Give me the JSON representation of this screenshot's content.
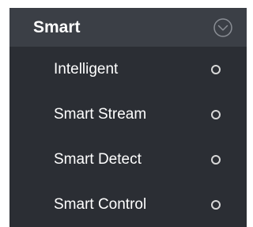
{
  "header": {
    "title": "Smart",
    "toggle_icon": "chevron-down-circle-icon"
  },
  "menu": {
    "items": [
      {
        "label": "Intelligent",
        "indicator_icon": "radio-circle-icon"
      },
      {
        "label": "Smart Stream",
        "indicator_icon": "radio-circle-icon"
      },
      {
        "label": "Smart Detect",
        "indicator_icon": "radio-circle-icon"
      },
      {
        "label": "Smart Control",
        "indicator_icon": "radio-circle-icon"
      }
    ]
  },
  "colors": {
    "header_bg": "#3b3f46",
    "menu_bg": "#2b2e34",
    "text": "#ffffff",
    "icon": "#d8d8d8"
  }
}
